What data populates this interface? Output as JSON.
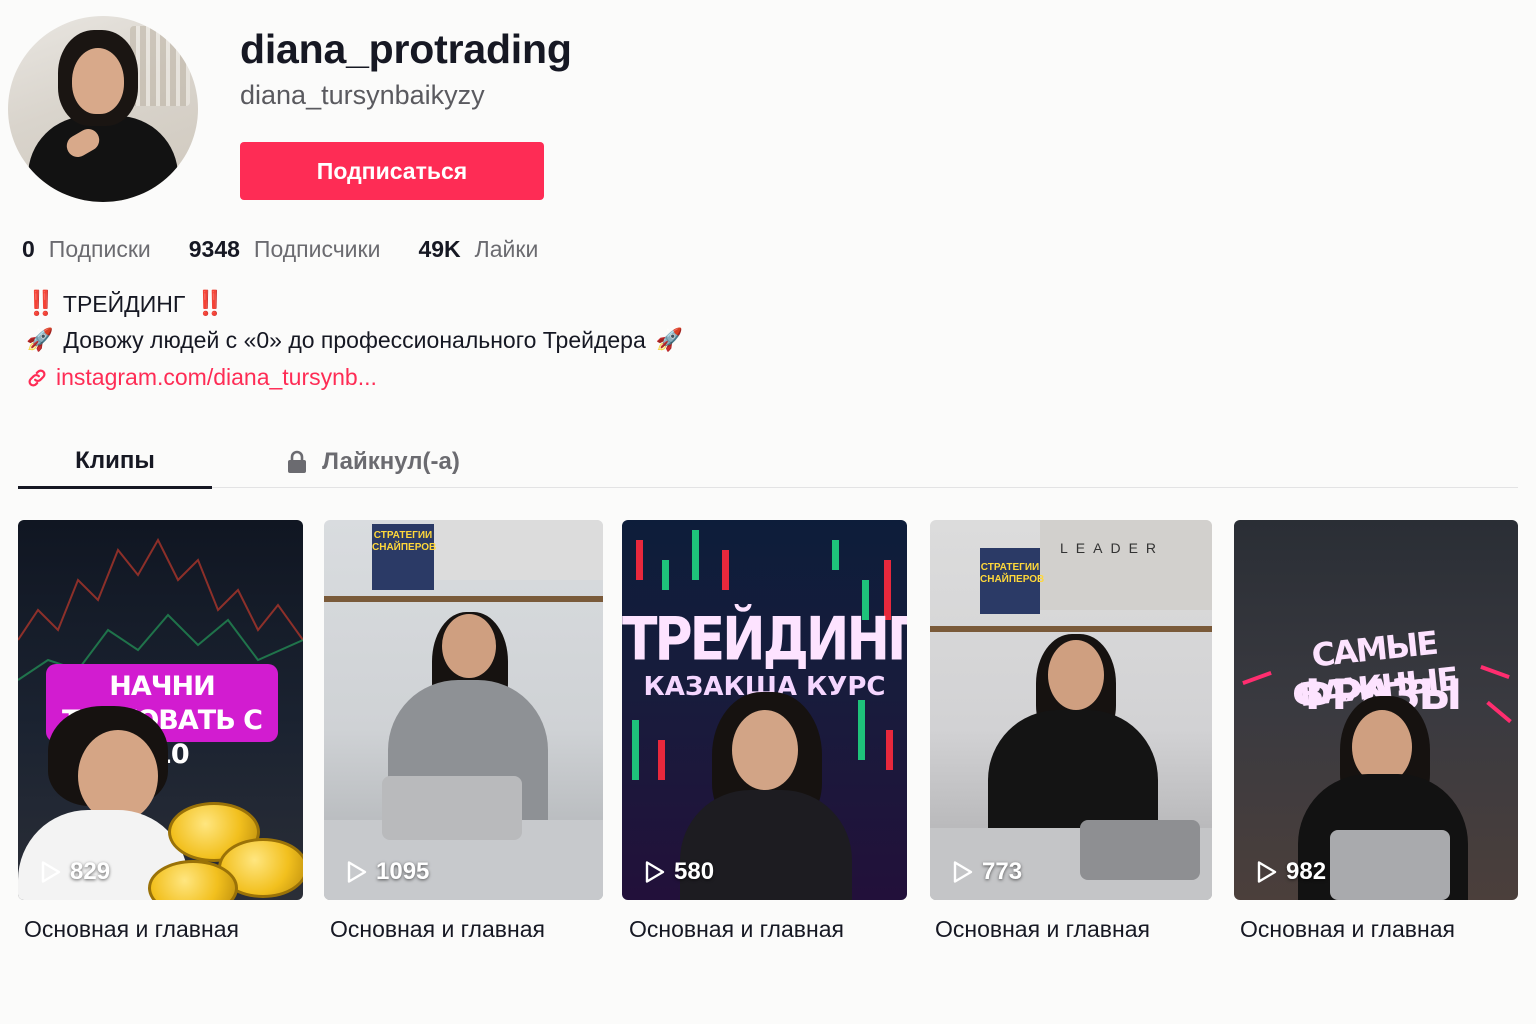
{
  "profile": {
    "username": "diana_protrading",
    "nickname": "diana_tursynbaikyzy",
    "follow_label": "Подписаться"
  },
  "stats": [
    {
      "value": "0",
      "label": "Подписки"
    },
    {
      "value": "9348",
      "label": "Подписчики"
    },
    {
      "value": "49K",
      "label": "Лайки"
    }
  ],
  "bio": {
    "line1": "ТРЕЙДИНГ",
    "line1_marker": "‼️",
    "line2": "Довожу людей с «0» до профессионального Трейдера",
    "line2_emoji": "🚀",
    "link": "instagram.com/diana_tursynb..."
  },
  "tabs": [
    {
      "label": "Клипы",
      "active": true
    },
    {
      "label": "Лайкнул(-а)",
      "active": false,
      "locked": true
    }
  ],
  "videos": [
    {
      "views": "829",
      "caption": "Основная и главная",
      "overlay": "НАЧНИ ТОРГОВАТЬ С $10"
    },
    {
      "views": "1095",
      "caption": "Основная и главная",
      "overlay": "СТРАТЕГИИ СНАЙПЕРОВ"
    },
    {
      "views": "580",
      "caption": "Основная и главная",
      "overlay": "ТРЕЙДИНГ",
      "overlay2": "КАЗАКША КУРС"
    },
    {
      "views": "773",
      "caption": "Основная и главная",
      "overlay": "LEADER",
      "overlay2": "СТРАТЕГИИ СНАЙПЕРОВ"
    },
    {
      "views": "982",
      "caption": "Основная и главная",
      "overlay": "САМЫЕ ВАЖНЫЕ",
      "overlay2": "ФРАЗЫ"
    }
  ],
  "colors": {
    "accent": "#fe2c55",
    "background": "#fbfbfa",
    "text": "#161823",
    "muted": "#6b6b70"
  },
  "icons": {
    "link": "link-icon",
    "lock": "lock-icon",
    "play": "play-icon"
  }
}
